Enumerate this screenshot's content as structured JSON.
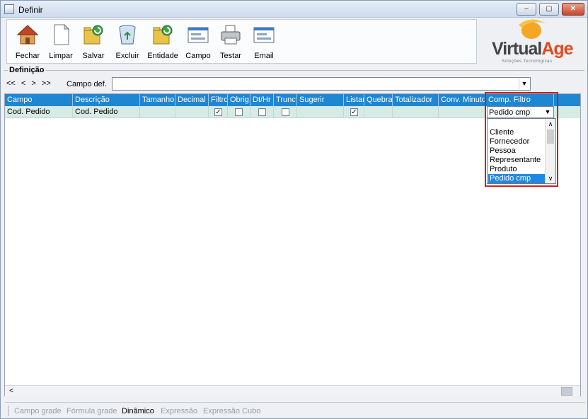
{
  "window": {
    "title": "Definir"
  },
  "titlebar_buttons": {
    "minimize": "–",
    "maximize": "▢",
    "close": "✕"
  },
  "toolbar": {
    "buttons": [
      {
        "label": "Fechar",
        "icon": "house-icon"
      },
      {
        "label": "Limpar",
        "icon": "blank-page-icon"
      },
      {
        "label": "Salvar",
        "icon": "folder-save-icon"
      },
      {
        "label": "Excluir",
        "icon": "recycle-bin-icon"
      },
      {
        "label": "Entidade",
        "icon": "folder-entity-icon"
      },
      {
        "label": "Campo",
        "icon": "field-window-icon"
      },
      {
        "label": "Testar",
        "icon": "printer-icon"
      },
      {
        "label": "Email",
        "icon": "email-window-icon"
      }
    ]
  },
  "logo": {
    "text_main": "Virtual",
    "text_accent": "Age",
    "tagline": "Soluções Tecnológicas",
    "accent_color": "#e04a1e"
  },
  "definicao": {
    "group_label": "Definição",
    "nav": [
      "<<",
      "<",
      ">",
      ">>"
    ],
    "campo_def_label": "Campo def.",
    "campo_def_value": ""
  },
  "grid": {
    "columns": [
      "Campo",
      "Descrição",
      "Tamanho",
      "Decimal",
      "Filtro",
      "Obrig.",
      "Dt/Hr",
      "Trunc",
      "Sugerir",
      "Listar",
      "Quebra",
      "Totalizador",
      "Conv. Minuto",
      "Comp. Filtro"
    ],
    "row": {
      "campo": "Cod. Pedido",
      "descricao": "Cod. Pedido",
      "tamanho": "",
      "decimal": "",
      "filtro": true,
      "obrig": false,
      "dthr": false,
      "trunc": false,
      "sugerir": "",
      "listar": true,
      "quebra": "",
      "totalizador": "",
      "conv_minuto": "",
      "comp_filtro": "Pedido cmp"
    },
    "header_color": "#1f86d2",
    "row_color": "#d6ebe6"
  },
  "comp_filtro_editor": {
    "value": "Pedido cmp",
    "options": [
      "",
      "Cliente",
      "Fornecedor",
      "Pessoa",
      "Representante",
      "Produto",
      "Pedido cmp"
    ],
    "selected": "Pedido cmp",
    "highlight_color": "#d11d1d"
  },
  "bottom_tabs": [
    {
      "label": "Campo grade",
      "active": false
    },
    {
      "label": "Fórmula grade",
      "active": false
    },
    {
      "label": "Dinâmico",
      "active": true
    },
    {
      "label": "Expressão",
      "active": false
    },
    {
      "label": "Expressão Cubo",
      "active": false
    }
  ],
  "symbols": {
    "check": "✓",
    "dropdown_arrow": "▼",
    "scroll_left": "<",
    "scroll_up": "∧",
    "scroll_down": "∨"
  }
}
